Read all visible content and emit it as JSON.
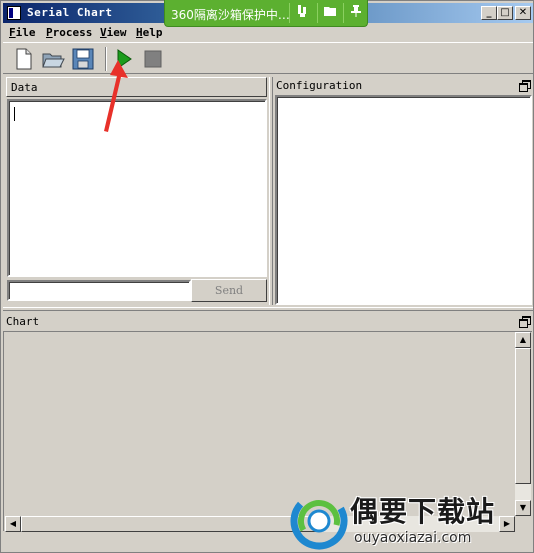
{
  "window": {
    "title": "Serial Chart",
    "min_label": "_",
    "max_label": "□",
    "close_label": "✕"
  },
  "sandbox_bar": {
    "text": "360隔离沙箱保护中…",
    "color": "#5cb030"
  },
  "menu": {
    "items": [
      {
        "label": "File",
        "accel": "F",
        "rest": "ile"
      },
      {
        "label": "Process",
        "accel": "P",
        "rest": "rocess"
      },
      {
        "label": "View",
        "accel": "V",
        "rest": "iew"
      },
      {
        "label": "Help",
        "accel": "H",
        "rest": "elp"
      }
    ]
  },
  "toolbar": {
    "icons": [
      "new-file-icon",
      "open-folder-icon",
      "save-icon",
      "run-icon",
      "stop-icon"
    ],
    "run_color": "#1c9c1c",
    "stop_color": "#808080"
  },
  "data_panel": {
    "header": "Data",
    "send_input_value": "",
    "send_label": "Send"
  },
  "config_panel": {
    "header": "Configuration"
  },
  "chart_panel": {
    "header": "Chart"
  },
  "scrollbars": {
    "up": "▲",
    "down": "▼",
    "left": "◀",
    "right": "▶"
  },
  "watermark": {
    "cn": "偶要下载站",
    "url": "ouyaoxiazai.com"
  },
  "annotation": {
    "arrow_color": "#e8312a"
  }
}
